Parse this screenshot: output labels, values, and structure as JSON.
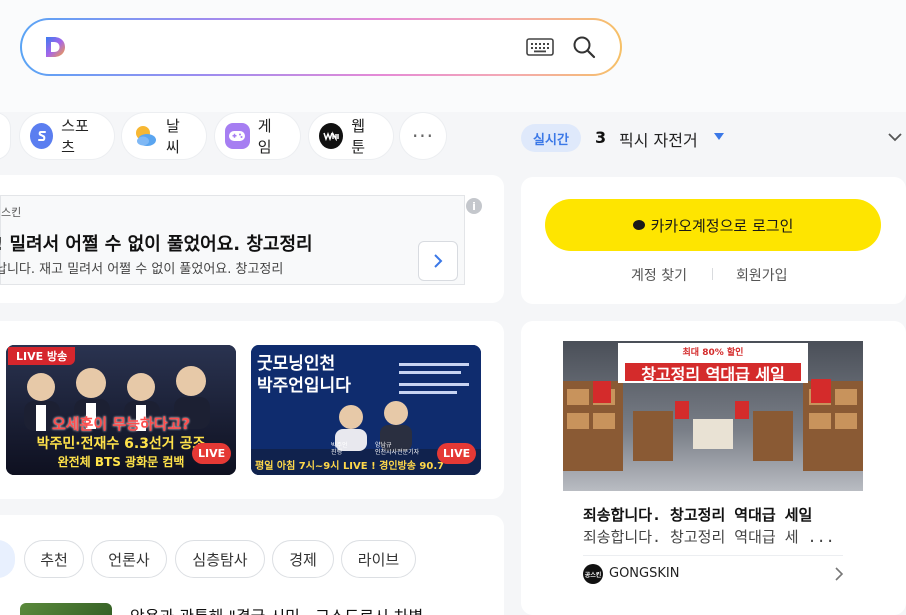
{
  "search": {
    "placeholder": ""
  },
  "chips": [
    {
      "label": "스포츠",
      "icon": "sports-icon"
    },
    {
      "label": "날씨",
      "icon": "weather-icon"
    },
    {
      "label": "게임",
      "icon": "game-icon"
    },
    {
      "label": "웹툰",
      "icon": "webtoon-icon"
    }
  ],
  "more_label": "···",
  "realtime": {
    "badge": "실시간",
    "rank": "3",
    "term": "픽시 자전거"
  },
  "ad": {
    "brand": "스킨",
    "title": "! 밀려서 어쩔 수 없이 풀었어요. 창고정리",
    "desc": "납니다. 재고 밀려서 어쩔 수 없이 풀었어요. 창고정리",
    "info": "i"
  },
  "live": [
    {
      "badge": "LIVE 방송",
      "line1": "오세훈이 무능하다고?",
      "line2": "박주민·전재수 6.3선거 공조",
      "line3": "완전체 BTS 광화문 컴백",
      "live_tag": "LIVE"
    },
    {
      "line1": "굿모닝인천",
      "line2": "박주언입니다",
      "host1": "박주언",
      "host1_role": "진행",
      "host2": "양남규",
      "host2_role": "인천시사전문기자",
      "bottom": "평일 아침 7시~9시 LIVE ! 경인방송 90.7",
      "live_tag": "LIVE"
    }
  ],
  "news_tabs": [
    "추천",
    "언론사",
    "심층탐사",
    "경제",
    "라이브"
  ],
  "news_headline": "악용과 관통해 \"결국 시민...고소도로시 차별",
  "login": {
    "kakao": "카카오계정으로 로그인",
    "find": "계정 찾기",
    "signup": "회원가입"
  },
  "gad": {
    "banner_small": "최대 80% 할인",
    "banner": "창고정리 역대급 세일",
    "title": "죄송합니다. 창고정리 역대급 세일",
    "desc": "죄송합니다. 창고정리 역대급 세 ...",
    "brand": "GONGSKIN",
    "logo_text": "공스킨"
  },
  "colors": {
    "kakao": "#FEE500",
    "accent": "#3B78E7",
    "live_red": "#E53935"
  }
}
